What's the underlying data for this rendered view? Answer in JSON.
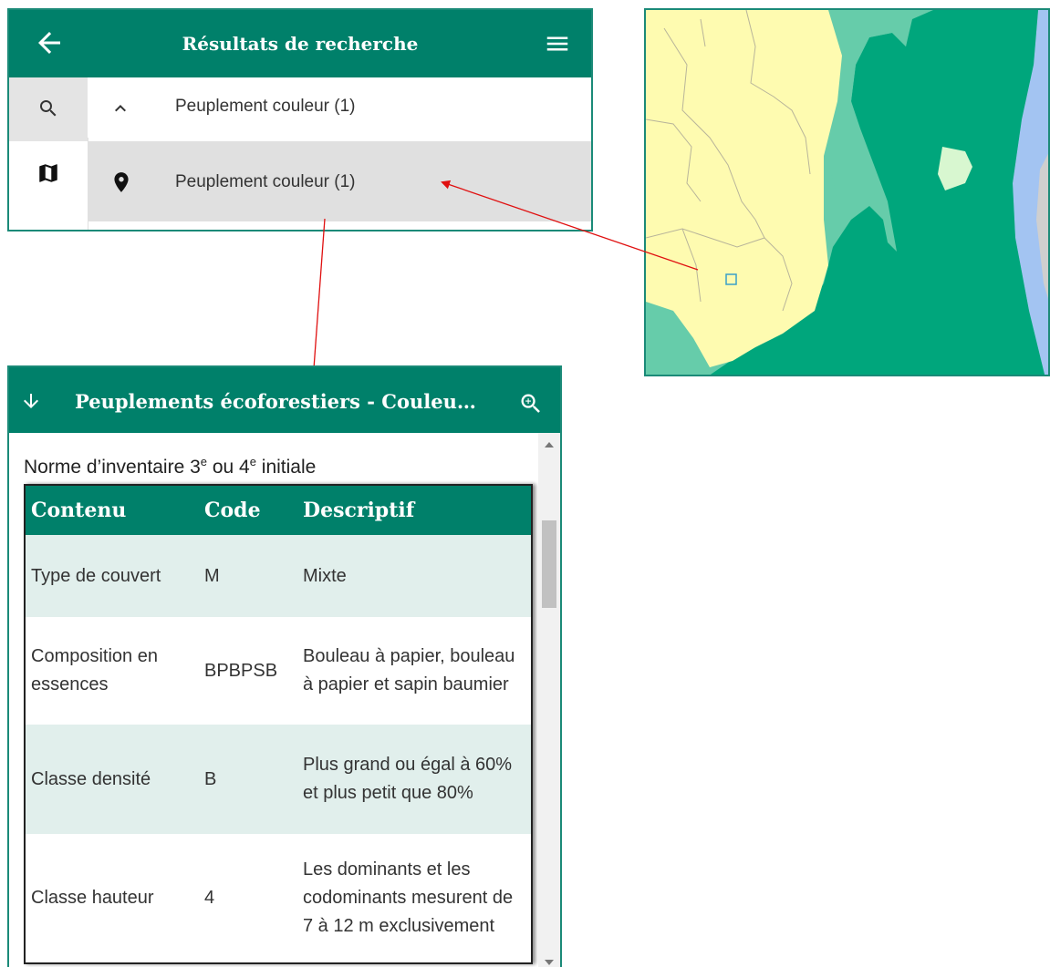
{
  "results_panel": {
    "title": "Résultats de recherche",
    "rows": [
      {
        "label": "Peuplement couleur (1)",
        "icon": "chevron-up-icon"
      },
      {
        "label": "Peuplement couleur (1)",
        "icon": "map-marker-icon"
      }
    ],
    "sidebar": [
      "search-icon",
      "map-icon"
    ]
  },
  "map": {
    "colors": {
      "yellow": "#fefbb0",
      "light_green": "#66ccaa",
      "dark_green": "#00a67c",
      "pale_green": "#d8f7d0",
      "blue": "#a3c4f2",
      "gray": "#cfcfcf"
    }
  },
  "attribute_panel": {
    "title": "Peuplements écoforestiers - Couleu…",
    "norme_prefix": "Norme d’inventaire 3",
    "norme_sup1": "e",
    "norme_mid": " ou 4",
    "norme_sup2": "e",
    "norme_suffix": " initiale",
    "columns": [
      "Contenu",
      "Code",
      "Descriptif"
    ],
    "rows": [
      {
        "contenu": "Type de couvert",
        "code": "M",
        "descriptif": "Mixte"
      },
      {
        "contenu": "Composition en essences",
        "code": "BPBPSB",
        "descriptif": "Bouleau à papier, bouleau à papier et sapin baumier"
      },
      {
        "contenu": "Classe densité",
        "code": "B",
        "descriptif": "Plus grand ou égal à 60% et plus petit que 80%"
      },
      {
        "contenu": "Classe hauteur",
        "code": "4",
        "descriptif": "Les dominants et les codominants mesurent de 7 à 12 m exclusivement"
      }
    ]
  },
  "colors": {
    "accent": "#00806a",
    "arrow": "#e01010"
  }
}
